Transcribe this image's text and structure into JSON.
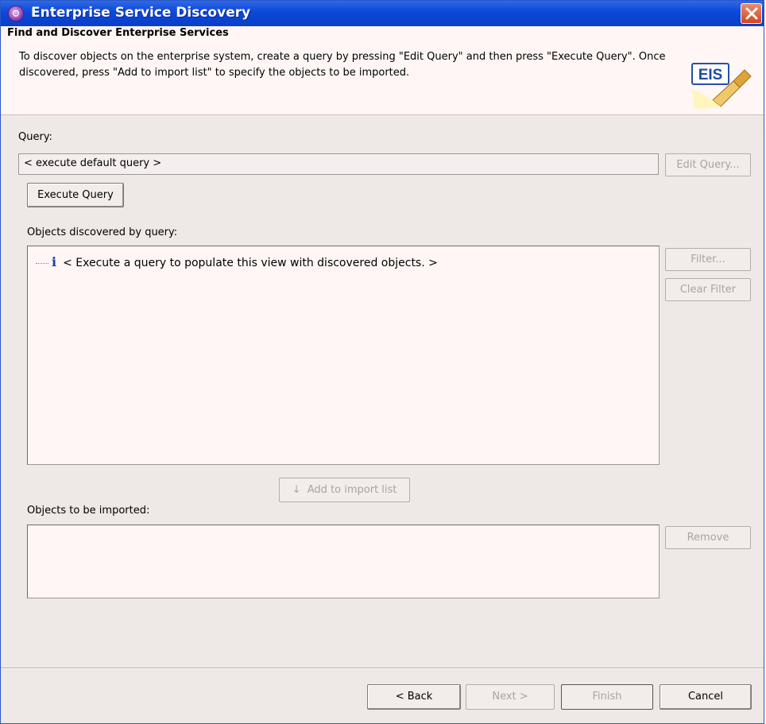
{
  "window": {
    "title": "Enterprise Service Discovery",
    "icon": "wizard-icon"
  },
  "banner": {
    "title": "Find and Discover Enterprise Services",
    "description": "To discover objects on the enterprise system, create a query by pressing \"Edit Query\" and then press \"Execute Query\". Once discovered, press \"Add to import list\" to specify the objects to be imported.",
    "logo_text": "EIS"
  },
  "query": {
    "label": "Query:",
    "value": "< execute default query >",
    "edit_button": "Edit Query...",
    "execute_button": "Execute Query"
  },
  "discovered": {
    "label": "Objects discovered by query:",
    "placeholder_item": "< Execute a query to populate this view with discovered objects. >",
    "filter_button": "Filter...",
    "clear_filter_button": "Clear Filter",
    "add_button": "Add to import list"
  },
  "imported": {
    "label": "Objects to be imported:",
    "remove_button": "Remove"
  },
  "footer": {
    "back": "< Back",
    "next": "Next >",
    "finish": "Finish",
    "cancel": "Cancel"
  },
  "colors": {
    "titlebar": "#0b47d8",
    "background": "#eee8e7",
    "list_background": "#fff6f5"
  }
}
